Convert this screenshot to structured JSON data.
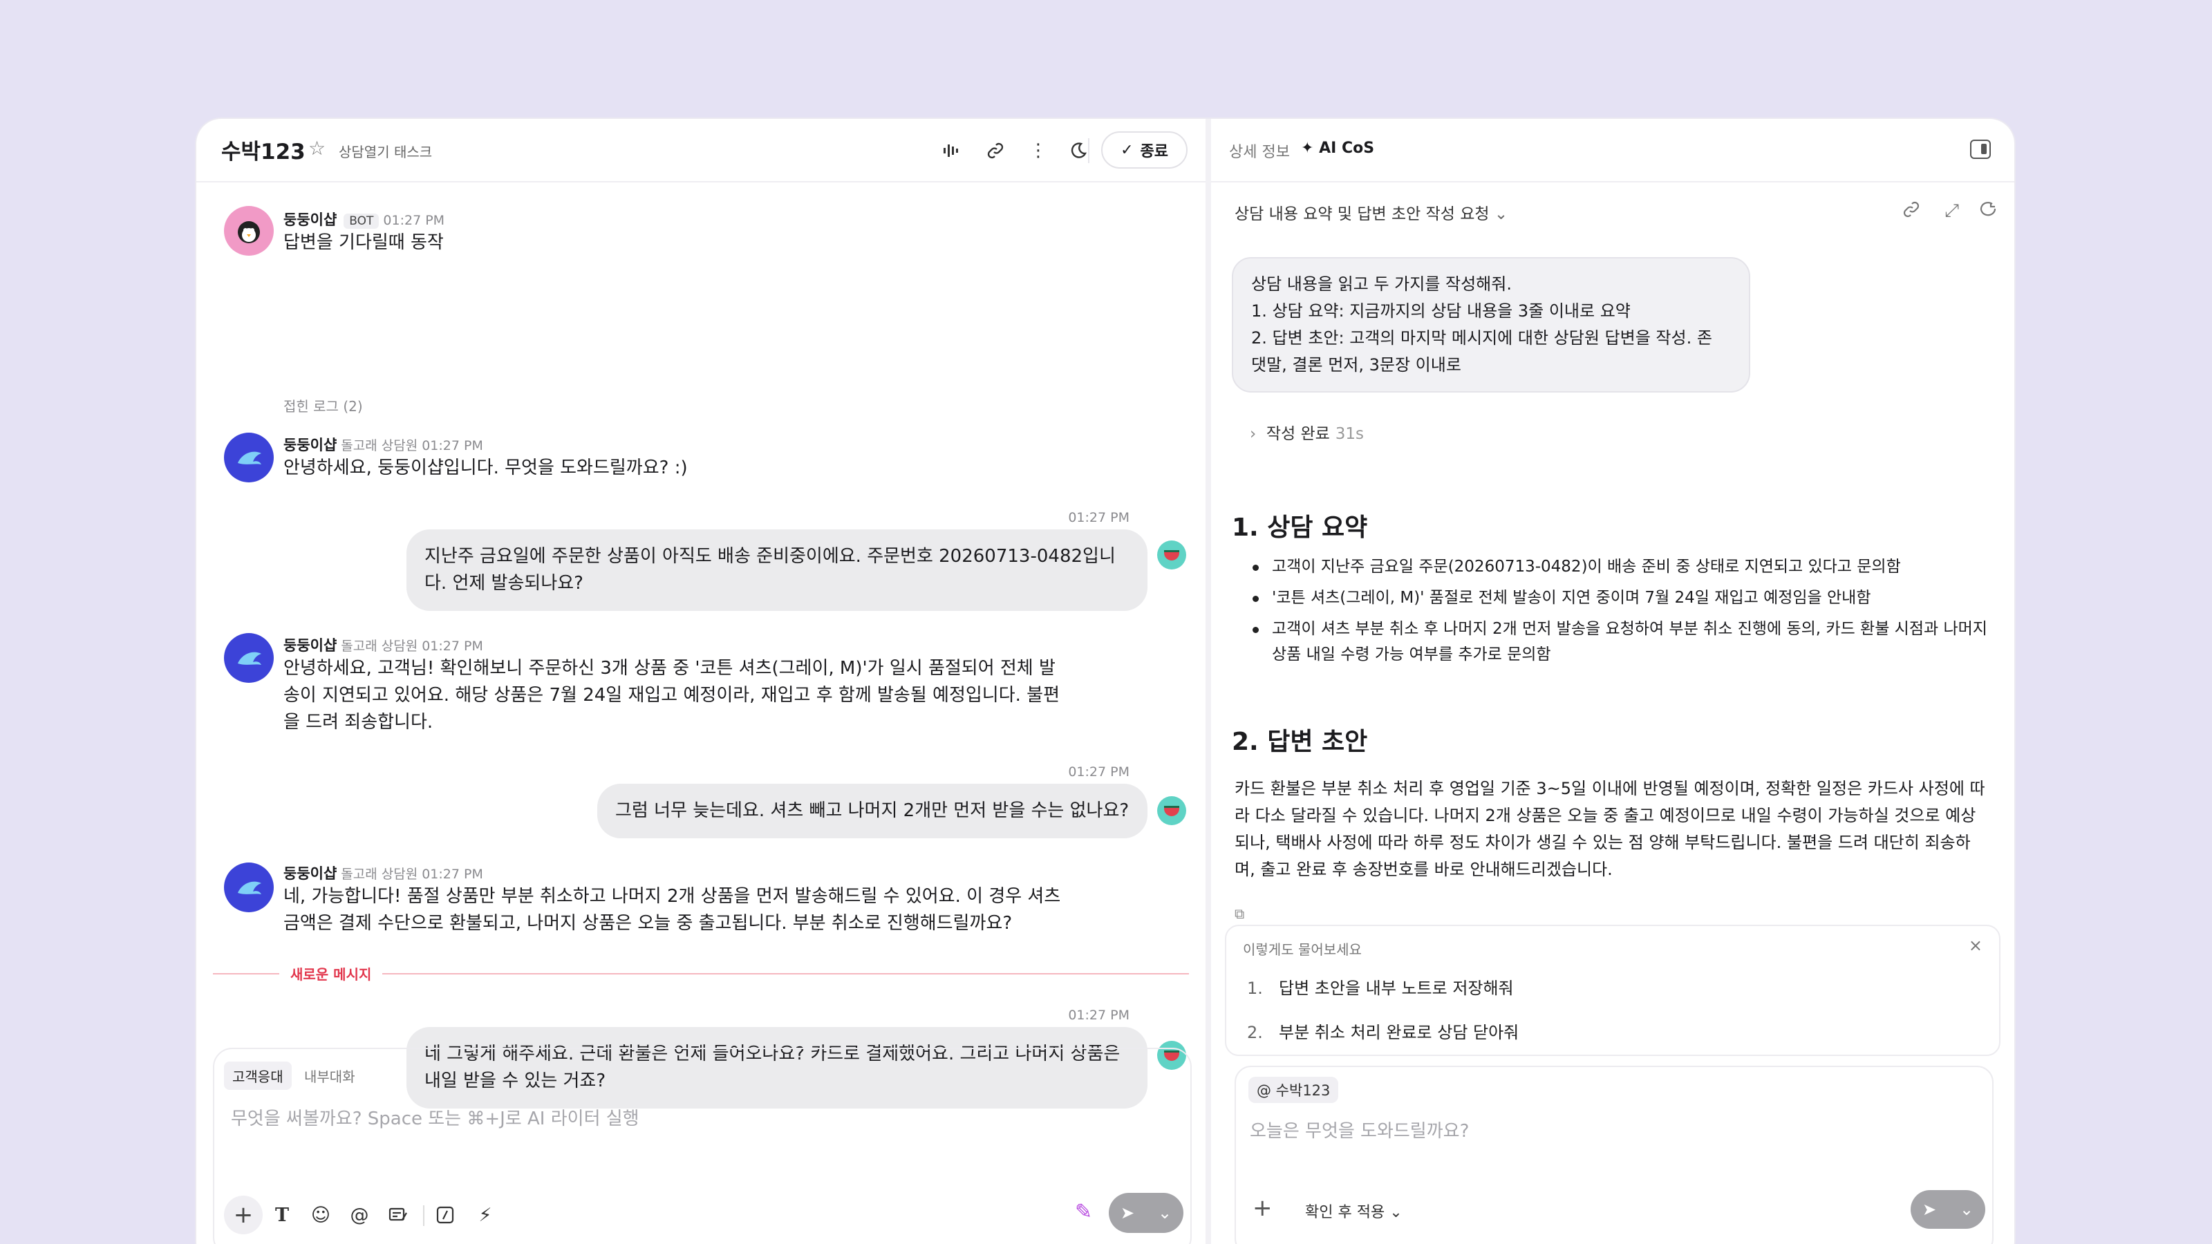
{
  "header": {
    "title": "수박123",
    "subtitle": "상담열기 태스크",
    "end_label": "종료"
  },
  "messages": {
    "bot": {
      "name": "둥둥이샵",
      "badge": "BOT",
      "time": "01:27 PM",
      "text": "답변을 기다릴때 동작"
    },
    "fold": "접힌 로그 (2)",
    "a1": {
      "name": "둥둥이샵",
      "role": "돌고래 상담원",
      "time": "01:27 PM",
      "text": "안녕하세요, 둥둥이샵입니다. 무엇을 도와드릴까요? :)"
    },
    "u1": {
      "time": "01:27 PM",
      "text": "지난주 금요일에 주문한 상품이 아직도 배송 준비중이에요. 주문번호 20260713-0482입니\n다. 언제 발송되나요?"
    },
    "a2": {
      "name": "둥둥이샵",
      "role": "돌고래 상담원",
      "time": "01:27 PM",
      "text": "안녕하세요, 고객님! 확인해보니 주문하신 3개 상품 중 '코튼 셔츠(그레이, M)'가 일시 품절되어 전체 발\n송이 지연되고 있어요. 해당 상품은 7월 24일 재입고 예정이라, 재입고 후 함께 발송될 예정입니다. 불편\n을 드려 죄송합니다."
    },
    "u2": {
      "time": "01:27 PM",
      "text": "그럼 너무 늦는데요. 셔츠 빼고 나머지 2개만 먼저 받을 수는 없나요?"
    },
    "a3": {
      "name": "둥둥이샵",
      "role": "돌고래 상담원",
      "time": "01:27 PM",
      "text": "네, 가능합니다! 품절 상품만 부분 취소하고 나머지 2개 상품을 먼저 발송해드릴 수 있어요. 이 경우 셔츠\n금액은 결제 수단으로 환불되고, 나머지 상품은 오늘 중 출고됩니다. 부분 취소로 진행해드릴까요?"
    },
    "new_label": "새로운 메시지",
    "u3": {
      "time": "01:27 PM",
      "text": "네 그렇게 해주세요. 근데 환불은 언제 들어오나요? 카드로 결제했어요. 그리고 나머지 상품은\n내일 받을 수 있는 거죠?"
    }
  },
  "composer": {
    "tab_customer": "고객응대",
    "tab_internal": "내부대화",
    "placeholder": "무엇을 써볼까요? Space 또는 ⌘+J로 AI 라이터 실행"
  },
  "right": {
    "tab_details": "상세 정보",
    "tab_ai": "AI CoS",
    "request_title": "상담 내용 요약 및 답변 초안 작성 요청",
    "prompt": "상담 내용을 읽고 두 가지를 작성해줘.\n1. 상담 요약: 지금까지의 상담 내용을 3줄 이내로 요약\n2. 답변 초안: 고객의 마지막 메시지에 대한 상담원 답변을 작성. 존\n댓말, 결론 먼저, 3문장 이내로",
    "done_label": "작성 완료",
    "done_time": "31s",
    "summary_heading": "1. 상담 요약",
    "summary": [
      "고객이 지난주 금요일 주문(20260713-0482)이 배송 준비 중 상태로 지연되고 있다고 문의함",
      "'코튼 셔츠(그레이, M)' 품절로 전체 발송이 지연 중이며 7월 24일 재입고 예정임을 안내함",
      "고객이 셔츠 부분 취소 후 나머지 2개 먼저 발송을 요청하여 부분 취소 진행에 동의, 카드 환불 시점과 나머지 상품 내일 수령 가능 여부를 추가로 문의함"
    ],
    "draft_heading": "2. 답변 초안",
    "draft": "카드 환불은 부분 취소 처리 후 영업일 기준 3~5일 이내에 반영될 예정이며, 정확한 일정은 카드사 사정에 따라 다소 달라질 수 있습니다. 나머지 2개 상품은 오늘 중 출고 예정이므로 내일 수령이 가능하실 것으로 예상되나, 택배사 사정에 따라 하루 정도 차이가 생길 수 있는 점 양해 부탁드립니다. 불편을 드려 대단히 죄송하며, 출고 완료 후 송장번호를 바로 안내해드리겠습니다.",
    "suggest_title": "이렇게도 물어보세요",
    "suggestions": [
      "답변 초안을 내부 노트로 저장해줘",
      "부분 취소 처리 완료로 상담 닫아줘"
    ],
    "chip": "@ 수박123",
    "placeholder": "오늘은 무엇을 도와드릴까요?",
    "apply_label": "확인 후 적용"
  }
}
